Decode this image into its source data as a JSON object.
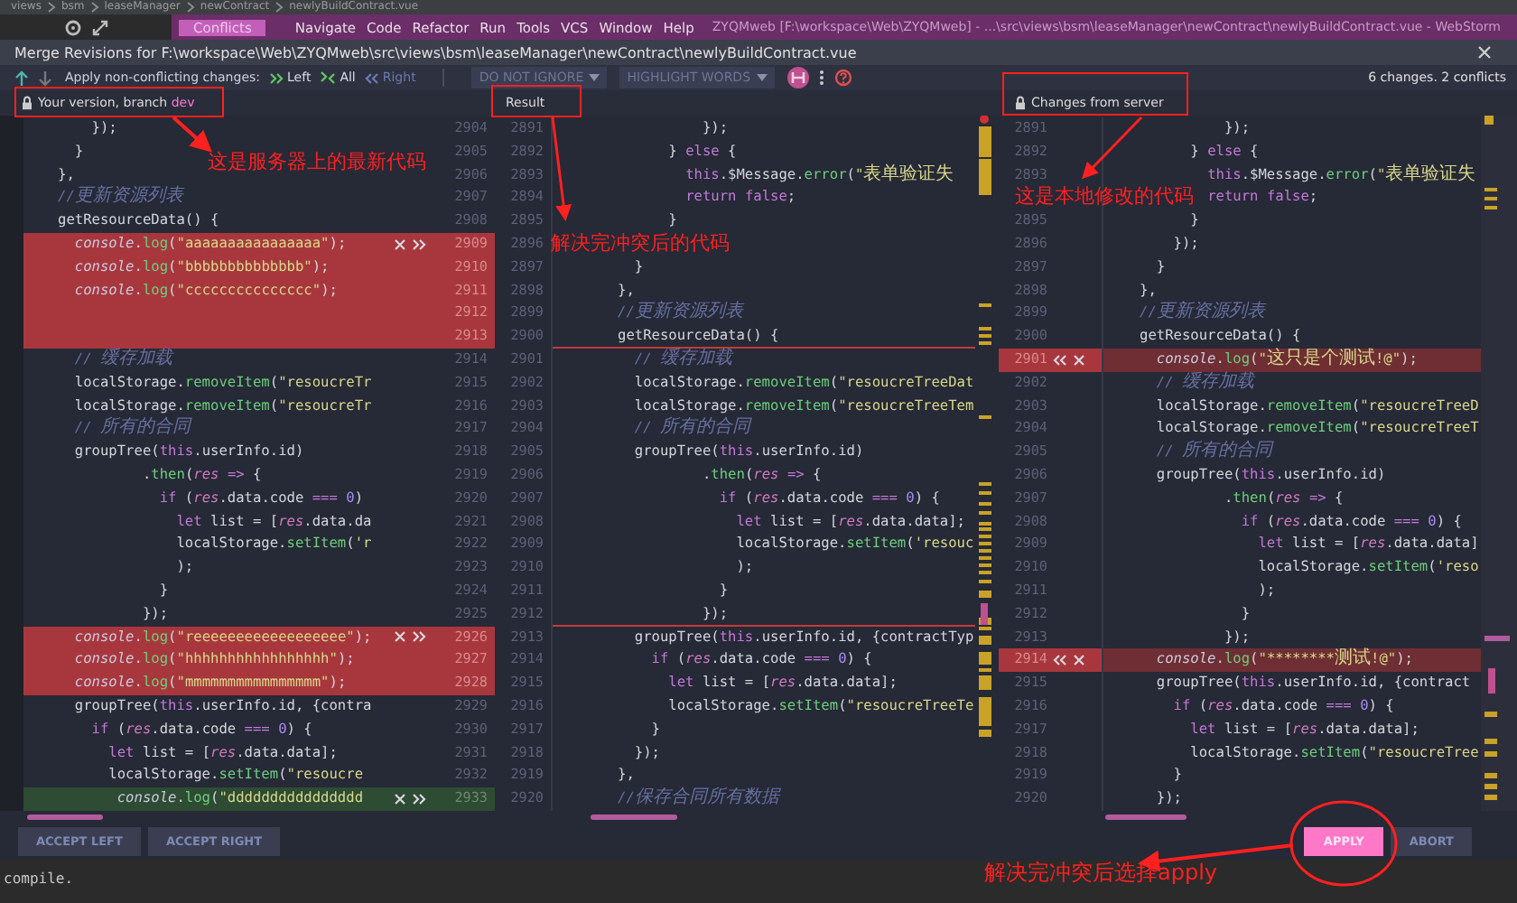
{
  "ide": {
    "breadcrumbs": [
      "views",
      "bsm",
      "leaseManager",
      "newContract",
      "newlyBuildContract.vue"
    ],
    "menu": [
      {
        "label": "Conflicts",
        "selected": true
      },
      {
        "label": "Navigate",
        "selected": false
      },
      {
        "label": "Code",
        "selected": false
      },
      {
        "label": "Refactor",
        "selected": false
      },
      {
        "label": "Run",
        "selected": false
      },
      {
        "label": "Tools",
        "selected": false
      },
      {
        "label": "VCS",
        "selected": false
      },
      {
        "label": "Window",
        "selected": false
      },
      {
        "label": "Help",
        "selected": false
      }
    ],
    "title": "ZYQMweb [F:\\workspace\\Web\\ZYQMweb] - ...\\src\\views\\bsm\\leaseManager\\newContract\\newlyBuildContract.vue - WebStorm"
  },
  "dialog": {
    "title": "Merge Revisions for F:\\workspace\\Web\\ZYQMweb\\src\\views\\bsm\\leaseManager\\newContract\\newlyBuildContract.vue"
  },
  "toolbar": {
    "apply_label": "Apply non-conflicting changes:",
    "apply_actions": [
      {
        "kind": "left",
        "label": "Left",
        "disabled": false
      },
      {
        "kind": "all",
        "label": "All",
        "disabled": false
      },
      {
        "kind": "right",
        "label": "Right",
        "disabled": true
      }
    ],
    "dropdowns": [
      "DO NOT IGNORE",
      "HIGHLIGHT WORDS"
    ],
    "summary": "6 changes. 2 conflicts"
  },
  "headers": {
    "left": {
      "label": "Your version, branch",
      "branch": "dev"
    },
    "middle": {
      "label": "Result"
    },
    "right": {
      "label": "Changes from server"
    }
  },
  "rows": [
    {
      "left": {
        "no": "2904",
        "code": "    });"
      },
      "middle": {
        "no": "2891",
        "code": "          });"
      },
      "right": {
        "no": "2891",
        "code": "          });"
      }
    },
    {
      "left": {
        "no": "2905",
        "code": "  }"
      },
      "middle": {
        "no": "2892",
        "code": "      } else {"
      },
      "right": {
        "no": "2892",
        "code": "      } else {"
      }
    },
    {
      "left": {
        "no": "2906",
        "code": "},"
      },
      "middle": {
        "no": "2893",
        "code": "        this.$Message.error(\"表单验证失"
      },
      "right": {
        "no": "2893",
        "code": "        this.$Message.error(\"表单验证失"
      }
    },
    {
      "left": {
        "no": "2907",
        "code": "//更新资源列表"
      },
      "middle": {
        "no": "2894",
        "code": "        return false;"
      },
      "right": {
        "code": "        return false;"
      }
    },
    {
      "left": {
        "no": "2908",
        "code": "getResourceData() {"
      },
      "middle": {
        "no": "2895",
        "code": "      }"
      },
      "right": {
        "no": "2895",
        "code": "      }"
      }
    },
    {
      "left": {
        "no": "2909",
        "code": "  console.log(\"aaaaaaaaaaaaaaaa\");",
        "conflict": true,
        "actions": true
      },
      "middle": {
        "no": "2896"
      },
      "right": {
        "no": "2896",
        "code": "    });"
      }
    },
    {
      "left": {
        "no": "2910",
        "code": "  console.log(\"bbbbbbbbbbbbbb\");",
        "conflict": true
      },
      "middle": {
        "no": "2897",
        "code": "  }"
      },
      "right": {
        "no": "2897",
        "code": "  }"
      }
    },
    {
      "left": {
        "no": "2911",
        "code": "  console.log(\"ccccccccccccccc\");",
        "conflict": true
      },
      "middle": {
        "no": "2898",
        "code": "},"
      },
      "right": {
        "no": "2898",
        "code": "},"
      }
    },
    {
      "left": {
        "no": "2912",
        "conflict": true
      },
      "middle": {
        "no": "2899",
        "code": "//更新资源列表"
      },
      "right": {
        "no": "2899",
        "code": "//更新资源列表"
      }
    },
    {
      "left": {
        "no": "2913",
        "conflict": true
      },
      "middle": {
        "no": "2900",
        "code": "getResourceData() {",
        "boundary": true
      },
      "right": {
        "no": "2900",
        "code": "getResourceData() {"
      }
    },
    {
      "left": {
        "no": "2914",
        "code": "  // 缓存加载"
      },
      "middle": {
        "no": "2901",
        "code": "  // 缓存加载"
      },
      "right": {
        "no": "2901",
        "code": "  console.log(\"这只是个测试!@\");",
        "conflict": true,
        "actions": true
      }
    },
    {
      "left": {
        "no": "2915",
        "code": "  localStorage.removeItem(\"resoucreTr"
      },
      "middle": {
        "no": "2902",
        "code": "  localStorage.removeItem(\"resoucreTreeDat"
      },
      "right": {
        "no": "2902",
        "code": "  // 缓存加载"
      }
    },
    {
      "left": {
        "no": "2916",
        "code": "  localStorage.removeItem(\"resoucreTr"
      },
      "middle": {
        "no": "2903",
        "code": "  localStorage.removeItem(\"resoucreTreeTem"
      },
      "right": {
        "no": "2903",
        "code": "  localStorage.removeItem(\"resoucreTreeD"
      }
    },
    {
      "left": {
        "no": "2917",
        "code": "  // 所有的合同"
      },
      "middle": {
        "no": "2904",
        "code": "  // 所有的合同"
      },
      "right": {
        "no": "2904",
        "code": "  localStorage.removeItem(\"resoucreTreeT"
      }
    },
    {
      "left": {
        "no": "2918",
        "code": "  groupTree(this.userInfo.id)"
      },
      "middle": {
        "no": "2905",
        "code": "  groupTree(this.userInfo.id)"
      },
      "right": {
        "no": "2905",
        "code": "  // 所有的合同"
      }
    },
    {
      "left": {
        "no": "2919",
        "code": "          .then(res => {"
      },
      "middle": {
        "no": "2906",
        "code": "          .then(res => {"
      },
      "right": {
        "no": "2906",
        "code": "  groupTree(this.userInfo.id)"
      }
    },
    {
      "left": {
        "no": "2920",
        "code": "            if (res.data.code === 0)"
      },
      "middle": {
        "no": "2907",
        "code": "            if (res.data.code === 0) {"
      },
      "right": {
        "no": "2907",
        "code": "          .then(res => {"
      }
    },
    {
      "left": {
        "no": "2921",
        "code": "              let list = [res.data.da"
      },
      "middle": {
        "no": "2908",
        "code": "              let list = [res.data.data];"
      },
      "right": {
        "no": "2908",
        "code": "            if (res.data.code === 0) {"
      }
    },
    {
      "left": {
        "no": "2922",
        "code": "              localStorage.setItem('r"
      },
      "middle": {
        "no": "2909",
        "code": "              localStorage.setItem('resouc"
      },
      "right": {
        "no": "2909",
        "code": "              let list = [res.data.data]"
      }
    },
    {
      "left": {
        "no": "2923",
        "code": "              );"
      },
      "middle": {
        "no": "2910",
        "code": "              );"
      },
      "right": {
        "no": "2910",
        "code": "              localStorage.setItem('reso"
      }
    },
    {
      "left": {
        "no": "2924",
        "code": "            }"
      },
      "middle": {
        "no": "2911",
        "code": "            }"
      },
      "right": {
        "no": "2911",
        "code": "              );"
      }
    },
    {
      "left": {
        "no": "2925",
        "code": "          });"
      },
      "middle": {
        "no": "2912",
        "code": "          });",
        "boundary": true
      },
      "right": {
        "no": "2912",
        "code": "            }"
      }
    },
    {
      "left": {
        "no": "2926",
        "code": "  console.log(\"reeeeeeeeeeeeeeeeee\");",
        "conflict": true,
        "actions": true
      },
      "middle": {
        "no": "2913",
        "code": "  groupTree(this.userInfo.id, {contractTyp"
      },
      "right": {
        "no": "2913",
        "code": "          });"
      }
    },
    {
      "left": {
        "no": "2927",
        "code": "  console.log(\"hhhhhhhhhhhhhhhhh\");",
        "conflict": true
      },
      "middle": {
        "no": "2914",
        "code": "    if (res.data.code === 0) {"
      },
      "right": {
        "no": "2914",
        "code": "  console.log(\"********测试!@\");",
        "conflict": true,
        "actions": true
      }
    },
    {
      "left": {
        "no": "2928",
        "code": "  console.log(\"mmmmmmmmmmmmmmmm\");",
        "conflict": true
      },
      "middle": {
        "no": "2915",
        "code": "      let list = [res.data.data];"
      },
      "right": {
        "no": "2915",
        "code": "  groupTree(this.userInfo.id, {contract"
      }
    },
    {
      "left": {
        "no": "2929",
        "code": "  groupTree(this.userInfo.id, {contra"
      },
      "middle": {
        "no": "2916",
        "code": "      localStorage.setItem(\"resoucreTreeTe"
      },
      "right": {
        "no": "2916",
        "code": "    if (res.data.code === 0) {"
      }
    },
    {
      "left": {
        "no": "2930",
        "code": "    if (res.data.code === 0) {"
      },
      "middle": {
        "no": "2917",
        "code": "    }"
      },
      "right": {
        "no": "2917",
        "code": "      let list = [res.data.data];"
      }
    },
    {
      "left": {
        "no": "2931",
        "code": "      let list = [res.data.data];"
      },
      "middle": {
        "no": "2918",
        "code": "  });"
      },
      "right": {
        "no": "2918",
        "code": "      localStorage.setItem(\"resoucreTree"
      }
    },
    {
      "left": {
        "no": "2932",
        "code": "      localStorage.setItem(\"resoucre"
      },
      "middle": {
        "no": "2919",
        "code": "},"
      },
      "right": {
        "no": "2919",
        "code": "    }"
      }
    },
    {
      "left": {
        "no": "2933",
        "code": "       console.log(\"dddddddddddddddd",
        "added": true,
        "actions": true
      },
      "middle": {
        "no": "2920",
        "code": "//保存合同所有数据"
      },
      "right": {
        "no": "2920",
        "code": "  });"
      }
    }
  ],
  "footer": {
    "left_buttons": [
      "ACCEPT LEFT",
      "ACCEPT RIGHT"
    ],
    "right_buttons": [
      {
        "label": "APPLY",
        "primary": true
      },
      {
        "label": "ABORT",
        "primary": false
      }
    ]
  },
  "annotations": [
    "这是服务器上的最新代码",
    "解决完冲突后的代码",
    "这是本地修改的代码",
    "解决完冲突后选择apply"
  ],
  "console": "compile."
}
